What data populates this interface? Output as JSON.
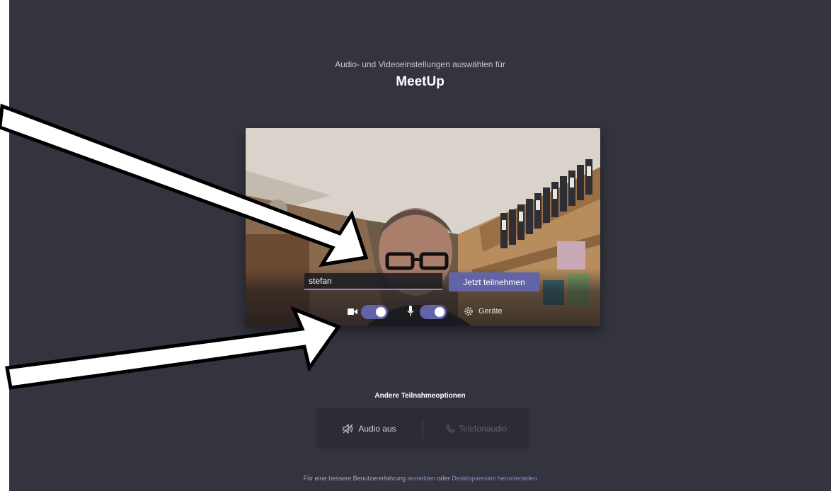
{
  "header": {
    "subtitle": "Audio- und Videoeinstellungen auswählen für",
    "title": "MeetUp"
  },
  "preview": {
    "name_value": "stefan",
    "join_label": "Jetzt teilnehmen",
    "camera_on": true,
    "microphone_on": true,
    "devices_label": "Geräte"
  },
  "other_options": {
    "heading": "Andere Teilnahmeoptionen",
    "audio_off_label": "Audio aus",
    "phone_audio_label": "Telefonaudio"
  },
  "footer": {
    "text_prefix": "Für eine bessere Benutzererfahrung",
    "signin_link": "anmelden",
    "text_middle": "oder",
    "download_link": "Desktopversion herunterladen"
  },
  "colors": {
    "background": "#34343f",
    "accent": "#6264a7",
    "link": "#8b8cc7"
  }
}
